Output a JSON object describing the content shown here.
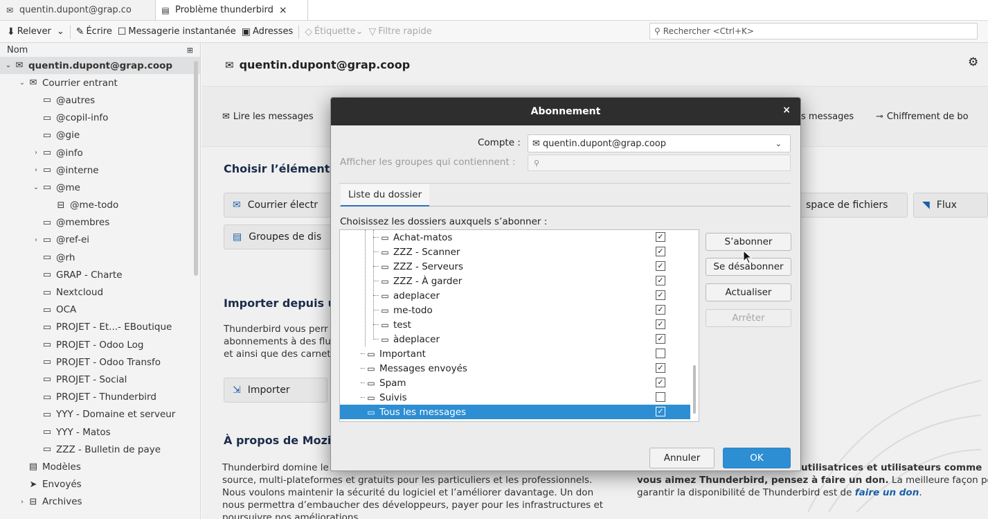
{
  "tabs": [
    {
      "label": "quentin.dupont@grap.co",
      "icon": "mail-account-icon"
    },
    {
      "label": "Problème thunderbird",
      "icon": "document-icon",
      "close": "×"
    }
  ],
  "toolbar": {
    "get_messages": "Relever",
    "write": "Écrire",
    "chat": "Messagerie instantanée",
    "addresses": "Adresses",
    "tag": "Étiquette",
    "quick_filter": "Filtre rapide",
    "search_placeholder": "Rechercher <Ctrl+K>"
  },
  "folder_pane": {
    "header": "Nom",
    "items": [
      {
        "label": "quentin.dupont@grap.coop"
      },
      {
        "label": "Courrier entrant"
      },
      {
        "label": "@autres"
      },
      {
        "label": "@copil-info"
      },
      {
        "label": "@gie"
      },
      {
        "label": "@info"
      },
      {
        "label": "@interne"
      },
      {
        "label": "@me"
      },
      {
        "label": "@me-todo"
      },
      {
        "label": "@membres"
      },
      {
        "label": "@ref-ei"
      },
      {
        "label": "@rh"
      },
      {
        "label": "GRAP - Charte"
      },
      {
        "label": "Nextcloud"
      },
      {
        "label": "OCA"
      },
      {
        "label": "PROJET - Et...- EBoutique"
      },
      {
        "label": "PROJET - Odoo Log"
      },
      {
        "label": "PROJET - Odoo Transfo"
      },
      {
        "label": "PROJET - Social"
      },
      {
        "label": "PROJET - Thunderbird"
      },
      {
        "label": "YYY - Domaine et serveur"
      },
      {
        "label": "YYY - Matos"
      },
      {
        "label": "ZZZ - Bulletin de paye"
      },
      {
        "label": "Modèles"
      },
      {
        "label": "Envoyés"
      },
      {
        "label": "Archives"
      }
    ]
  },
  "main": {
    "account_title": "quentin.dupont@grap.coop",
    "read_messages": "Lire les messages",
    "messages_right": "s messages",
    "encryption": "Chiffrement de bo",
    "choose_heading": "Choisir l’élément",
    "btn_mail": "Courrier électr",
    "btn_files": "space de fichiers",
    "btn_feeds": "Flux",
    "btn_groups": "Groupes de dis",
    "import_heading": "Importer depuis u",
    "import_text_1": "Thunderbird vous perr",
    "import_text_2": "abonnements à des flu",
    "import_text_3": "et ainsi que des carnet",
    "import_button": "Importer",
    "about_heading": "À propos de Mozi",
    "about_line_1": "Thunderbird domine le",
    "about_line_2": "source, multi-plateformes et gratuits pour les particuliers et les professionnels.",
    "about_line_3": "Nous voulons maintenir la sécurité du logiciel et l’améliorer davantage. Un don",
    "about_line_4": "nous permettra d’embaucher des développeurs, payer pour les infrastructures et",
    "about_line_5": "poursuivre nos améliorations.",
    "donate_line_1": "utilisatrices et utilisateurs comme",
    "donate_line_2_bold": "vous aimez Thunderbird, pensez à faire un don.",
    "donate_line_2_rest": " La meilleure façon po",
    "donate_line_3": "garantir la disponibilité de Thunderbird est de ",
    "donate_link": "faire un don",
    "donate_end": "."
  },
  "dialog": {
    "title": "Abonnement",
    "close": "×",
    "account_label": "Compte :",
    "account_value": "quentin.dupont@grap.coop",
    "filter_label": "Afficher les groupes qui contiennent :",
    "tab_label": "Liste du dossier",
    "instruction": "Choisissez les dossiers auxquels s’abonner :",
    "folders": [
      {
        "label": "Achat-matos",
        "checked": true,
        "level": 2
      },
      {
        "label": "ZZZ - Scanner",
        "checked": true,
        "level": 2
      },
      {
        "label": "ZZZ - Serveurs",
        "checked": true,
        "level": 2
      },
      {
        "label": "ZZZ - À garder",
        "checked": true,
        "level": 2
      },
      {
        "label": "adeplacer",
        "checked": true,
        "level": 2
      },
      {
        "label": "me-todo",
        "checked": true,
        "level": 2
      },
      {
        "label": "test",
        "checked": true,
        "level": 2
      },
      {
        "label": "àdeplacer",
        "checked": true,
        "level": 2
      },
      {
        "label": "Important",
        "checked": false,
        "level": 1
      },
      {
        "label": "Messages envoyés",
        "checked": true,
        "level": 1
      },
      {
        "label": "Spam",
        "checked": true,
        "level": 1
      },
      {
        "label": "Suivis",
        "checked": false,
        "level": 1
      },
      {
        "label": "Tous les messages",
        "checked": true,
        "level": 1,
        "selected": true
      }
    ],
    "btn_subscribe": "S’abonner",
    "btn_unsubscribe": "Se désabonner",
    "btn_refresh": "Actualiser",
    "btn_stop": "Arrêter",
    "btn_cancel": "Annuler",
    "btn_ok": "OK"
  },
  "colors": {
    "accent": "#2d8ed3",
    "title_bar": "#2e2e2e",
    "link": "#1a5fa8"
  }
}
